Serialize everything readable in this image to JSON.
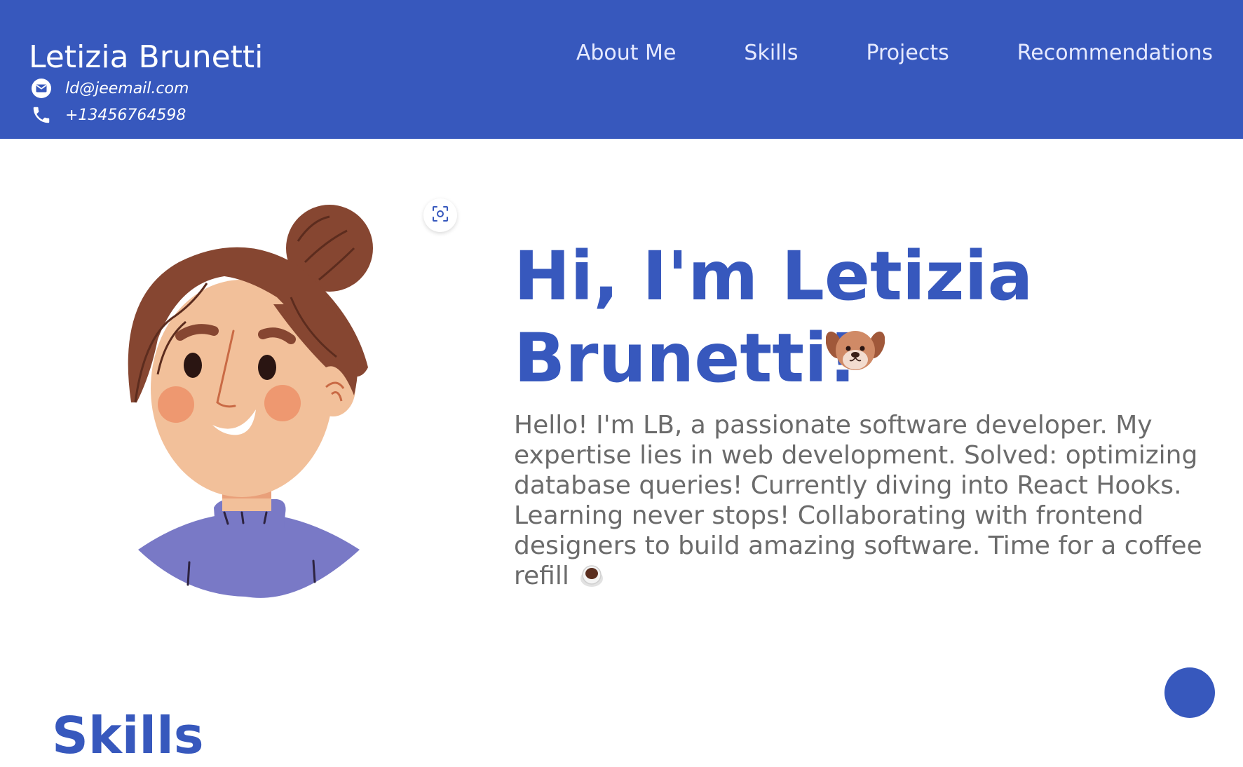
{
  "header": {
    "name": "Letizia Brunetti",
    "email": "ld@jeemail.com",
    "phone": "+13456764598",
    "nav": [
      {
        "label": "About Me"
      },
      {
        "label": "Skills"
      },
      {
        "label": "Projects"
      },
      {
        "label": "Recommendations"
      }
    ]
  },
  "hero": {
    "title": "Hi, I'm Letizia Brunetti!",
    "text": "Hello! I'm LB, a passionate software developer. My expertise lies in web development. Solved: optimizing database queries! Currently diving into React Hooks. Learning never stops! Collaborating with frontend designers to build amazing software. Time for a coffee refill",
    "title_emoji": "dog-face-icon",
    "text_emoji": "coffee-icon"
  },
  "sections": {
    "next_title": "Skills"
  },
  "colors": {
    "primary": "#3758bd",
    "text_muted": "#6b6b6b",
    "background": "#ffffff"
  }
}
